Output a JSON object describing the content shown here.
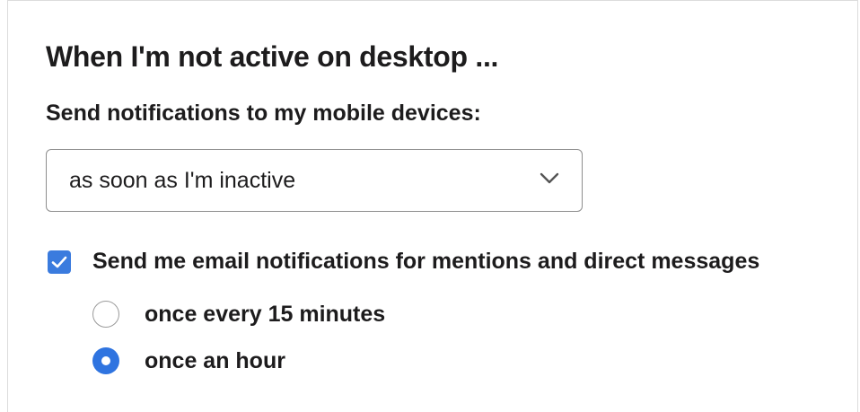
{
  "section": {
    "heading": "When I'm not active on desktop ...",
    "mobile_label": "Send notifications to my mobile devices:",
    "mobile_select": {
      "selected": "as soon as I'm inactive",
      "icon": "chevron-down-icon"
    },
    "email": {
      "checkbox_label": "Send me email notifications for mentions and direct messages",
      "checked": true,
      "options": [
        {
          "label": "once every 15 minutes",
          "selected": false
        },
        {
          "label": "once an hour",
          "selected": true
        }
      ]
    }
  },
  "colors": {
    "accent": "#2f74e0",
    "text": "#1d1c1d",
    "border": "#8d8d8d"
  }
}
